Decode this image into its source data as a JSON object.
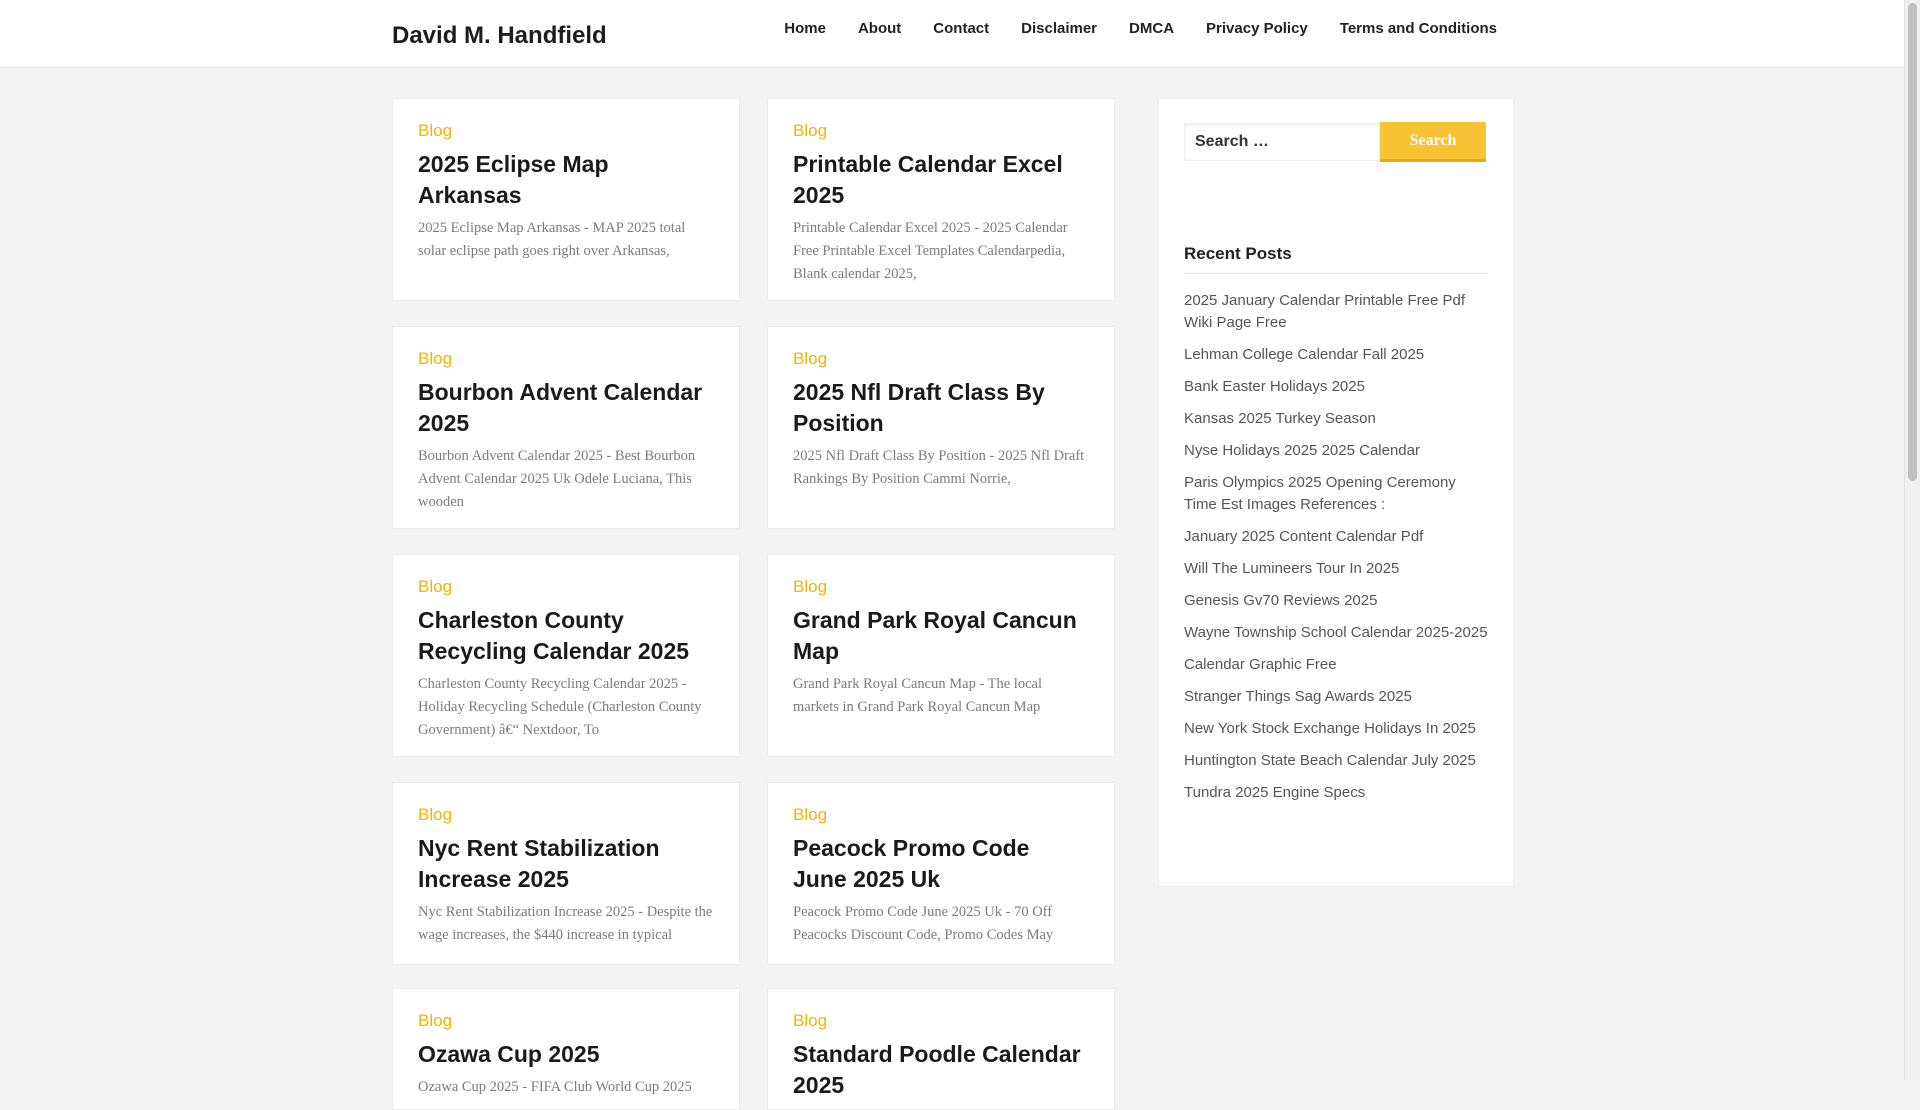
{
  "site": {
    "title": "David M. Handfield"
  },
  "nav": [
    "Home",
    "About",
    "Contact",
    "Disclaimer",
    "DMCA",
    "Privacy Policy",
    "Terms and Conditions"
  ],
  "posts": [
    {
      "category": "Blog",
      "title": "2025 Eclipse Map Arkansas",
      "excerpt": "2025 Eclipse Map Arkansas - MAP 2025 total solar eclipse path goes right over Arkansas,"
    },
    {
      "category": "Blog",
      "title": "Printable Calendar Excel 2025",
      "excerpt": "Printable Calendar Excel 2025 - 2025 Calendar Free Printable Excel Templates Calendarpedia, Blank calendar 2025,"
    },
    {
      "category": "Blog",
      "title": "Bourbon Advent Calendar 2025",
      "excerpt": "Bourbon Advent Calendar 2025 - Best Bourbon Advent Calendar 2025 Uk Odele Luciana, This wooden"
    },
    {
      "category": "Blog",
      "title": "2025 Nfl Draft Class By Position",
      "excerpt": "2025 Nfl Draft Class By Position - 2025 Nfl Draft Rankings By Position Cammi Norrie,"
    },
    {
      "category": "Blog",
      "title": "Charleston County Recycling Calendar 2025",
      "excerpt": "Charleston County Recycling Calendar 2025 - Holiday Recycling Schedule (Charleston County Government) â€“ Nextdoor, To"
    },
    {
      "category": "Blog",
      "title": "Grand Park Royal Cancun Map",
      "excerpt": "Grand Park Royal Cancun Map - The local markets in Grand Park Royal Cancun Map"
    },
    {
      "category": "Blog",
      "title": "Nyc Rent Stabilization Increase 2025",
      "excerpt": "Nyc Rent Stabilization Increase 2025 - Despite the wage increases, the $440 increase in typical"
    },
    {
      "category": "Blog",
      "title": "Peacock Promo Code June 2025 Uk",
      "excerpt": "Peacock Promo Code June 2025 Uk - 70 Off Peacocks Discount Code, Promo Codes May"
    },
    {
      "category": "Blog",
      "title": "Ozawa Cup 2025",
      "excerpt": "Ozawa Cup 2025 - FIFA Club World Cup 2025"
    },
    {
      "category": "Blog",
      "title": "Standard Poodle Calendar 2025",
      "excerpt": ""
    }
  ],
  "sidebar": {
    "search_placeholder": "Search …",
    "search_button": "Search",
    "recent_title": "Recent Posts",
    "recent_posts": [
      "2025 January Calendar Printable Free Pdf Wiki Page Free",
      "Lehman College Calendar Fall 2025",
      "Bank Easter Holidays 2025",
      "Kansas 2025 Turkey Season",
      "Nyse Holidays 2025 2025 Calendar",
      "Paris Olympics 2025 Opening Ceremony Time Est Images References :",
      "January 2025 Content Calendar Pdf",
      "Will The Lumineers Tour In 2025",
      "Genesis Gv70 Reviews 2025",
      "Wayne Township School Calendar 2025-2025",
      "Calendar Graphic Free",
      "Stranger Things Sag Awards 2025",
      "New York Stock Exchange Holidays In 2025",
      "Huntington State Beach Calendar July 2025",
      "Tundra 2025 Engine Specs"
    ]
  }
}
